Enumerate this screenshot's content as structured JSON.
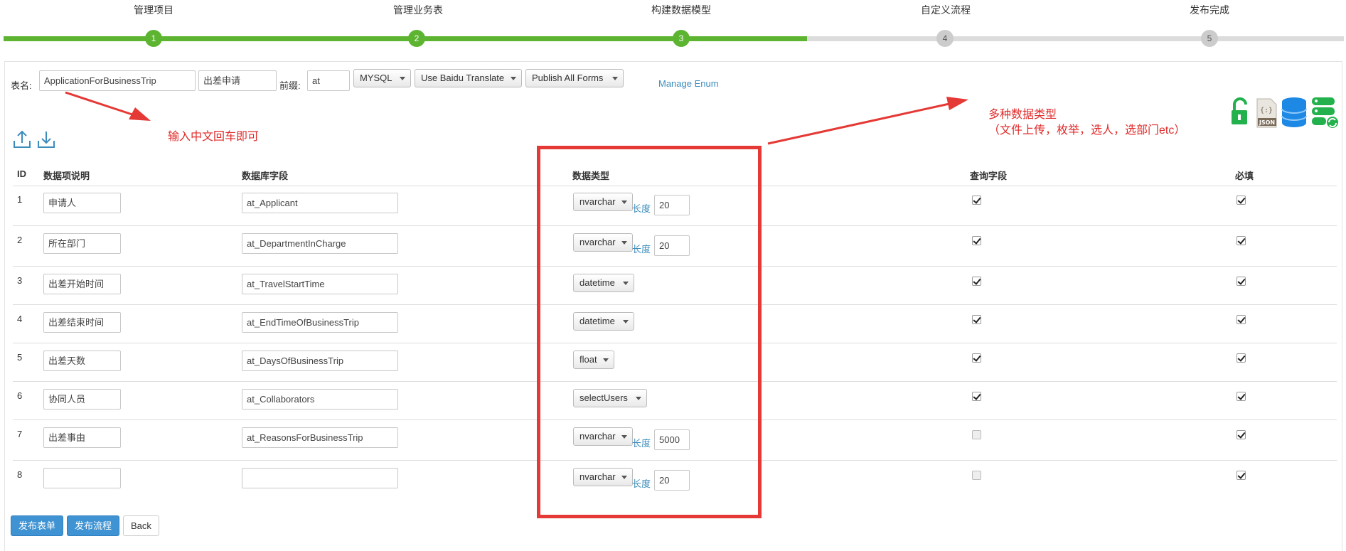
{
  "wizard": {
    "steps": [
      {
        "label": "管理项目",
        "num": "1"
      },
      {
        "label": "管理业务表",
        "num": "2"
      },
      {
        "label": "构建数据模型",
        "num": "3"
      },
      {
        "label": "自定义流程",
        "num": "4"
      },
      {
        "label": "发布完成",
        "num": "5"
      }
    ],
    "current_step": 3
  },
  "form": {
    "table_name_label": "表名:",
    "table_name_value": "ApplicationForBusinessTrip",
    "table_cn_value": "出差申请",
    "prefix_label": "前缀:",
    "prefix_value": "at",
    "db_select": "MYSQL",
    "translate_select": "Use Baidu Translate",
    "publish_select": "Publish All Forms",
    "manage_enum": "Manage Enum"
  },
  "annotations": {
    "hint_left": "输入中文回车即可",
    "hint_right_line1": "多种数据类型",
    "hint_right_line2": "（文件上传，枚举，选人，选部门etc）"
  },
  "toolbar_icons": [
    "upload-icon",
    "download-icon",
    "unlock-icon",
    "json-file-icon",
    "database-icon",
    "db-sync-icon"
  ],
  "table": {
    "headers": {
      "id": "ID",
      "desc": "数据项说明",
      "field": "数据库字段",
      "type": "数据类型",
      "query": "查询字段",
      "required": "必填"
    },
    "length_label": "长度",
    "rows": [
      {
        "id": "1",
        "desc": "申请人",
        "field": "at_Applicant",
        "type": "nvarchar",
        "length": "20",
        "query": true,
        "required": true
      },
      {
        "id": "2",
        "desc": "所在部门",
        "field": "at_DepartmentInCharge",
        "type": "nvarchar",
        "length": "20",
        "query": true,
        "required": true
      },
      {
        "id": "3",
        "desc": "出差开始时间",
        "field": "at_TravelStartTime",
        "type": "datetime",
        "length": "",
        "query": true,
        "required": true
      },
      {
        "id": "4",
        "desc": "出差结束时间",
        "field": "at_EndTimeOfBusinessTrip",
        "type": "datetime",
        "length": "",
        "query": true,
        "required": true
      },
      {
        "id": "5",
        "desc": "出差天数",
        "field": "at_DaysOfBusinessTrip",
        "type": "float",
        "length": "",
        "query": true,
        "required": true
      },
      {
        "id": "6",
        "desc": "协同人员",
        "field": "at_Collaborators",
        "type": "selectUsers",
        "length": "",
        "query": true,
        "required": true
      },
      {
        "id": "7",
        "desc": "出差事由",
        "field": "at_ReasonsForBusinessTrip",
        "type": "nvarchar",
        "length": "5000",
        "query": false,
        "required": true
      },
      {
        "id": "8",
        "desc": "",
        "field": "",
        "type": "nvarchar",
        "length": "20",
        "query": false,
        "required": true
      }
    ]
  },
  "buttons": {
    "publish_form": "发布表单",
    "publish_flow": "发布流程",
    "back": "Back"
  },
  "colors": {
    "progress_done": "#5cb431",
    "progress_todo": "#dcdcdc",
    "primary_button": "#3f93d3",
    "link": "#3c8dbc",
    "annotation_red": "#e53935"
  }
}
